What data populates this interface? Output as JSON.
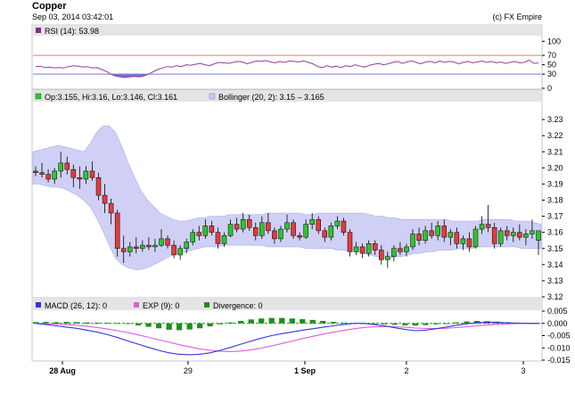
{
  "header": {
    "title": "Copper",
    "date": "Sep 03, 2014 03:42:01",
    "copyright": "(c) FX Empire"
  },
  "colors": {
    "up": "#2ec52e",
    "down": "#e33c3c",
    "band": "#c8c8f5",
    "rsi": "#9a3a9a",
    "macd": "#3535d9",
    "signal": "#e05be0",
    "divergence": "#1f8f1f",
    "panel_header": "#e4e4e4"
  },
  "x_labels": [
    "28 Aug",
    "29",
    "1 Sep",
    "2",
    "3"
  ],
  "chart_data": [
    {
      "type": "line",
      "panel": "rsi",
      "legend": "RSI (14): 53.98",
      "ylim": [
        0,
        110
      ],
      "yticks": [
        0,
        30,
        50,
        70,
        100
      ],
      "reference_lines": [
        30,
        70
      ],
      "series": [
        {
          "name": "RSI (14)",
          "values": [
            46,
            47,
            44,
            45,
            43,
            44,
            43,
            46,
            48,
            47,
            45,
            46,
            43,
            44,
            40,
            36,
            30,
            26,
            24,
            23,
            24,
            25,
            24,
            26,
            30,
            35,
            40,
            43,
            46,
            45,
            48,
            46,
            50,
            49,
            51,
            53,
            50,
            48,
            52,
            55,
            54,
            53,
            55,
            57,
            56,
            52,
            55,
            58,
            57,
            59,
            56,
            54,
            57,
            55,
            58,
            57,
            56,
            58,
            55,
            52,
            46,
            44,
            48,
            45,
            47,
            44,
            48,
            46,
            50,
            47,
            45,
            49,
            51,
            53,
            50,
            52,
            55,
            57,
            53,
            56,
            58,
            55,
            52,
            56,
            57,
            54,
            58,
            55,
            57,
            56,
            52,
            55,
            57,
            54,
            56,
            58,
            55,
            57,
            54,
            56,
            53,
            55,
            57,
            54,
            55,
            60,
            53,
            54
          ]
        }
      ]
    },
    {
      "type": "candlestick",
      "panel": "price",
      "legend_ohlc": "Op:3.155, Hi:3.16, Lo:3.146, Cl:3.161",
      "legend_bollinger": "Bollinger (20, 2): 3.15 – 3.165",
      "ylim": [
        3.12,
        3.24
      ],
      "yticks": [
        3.12,
        3.13,
        3.14,
        3.15,
        3.16,
        3.17,
        3.18,
        3.19,
        3.2,
        3.21,
        3.22,
        3.23
      ],
      "ohlc": [
        [
          3.198,
          3.201,
          3.195,
          3.197
        ],
        [
          3.197,
          3.203,
          3.194,
          3.196
        ],
        [
          3.196,
          3.199,
          3.191,
          3.193
        ],
        [
          3.193,
          3.2,
          3.19,
          3.198
        ],
        [
          3.198,
          3.21,
          3.194,
          3.203
        ],
        [
          3.203,
          3.207,
          3.196,
          3.199
        ],
        [
          3.199,
          3.202,
          3.188,
          3.194
        ],
        [
          3.194,
          3.201,
          3.187,
          3.193
        ],
        [
          3.193,
          3.201,
          3.19,
          3.198
        ],
        [
          3.198,
          3.204,
          3.192,
          3.194
        ],
        [
          3.194,
          3.197,
          3.18,
          3.183
        ],
        [
          3.183,
          3.19,
          3.172,
          3.178
        ],
        [
          3.178,
          3.181,
          3.165,
          3.172
        ],
        [
          3.172,
          3.174,
          3.145,
          3.15
        ],
        [
          3.15,
          3.158,
          3.141,
          3.148
        ],
        [
          3.148,
          3.154,
          3.145,
          3.151
        ],
        [
          3.151,
          3.157,
          3.147,
          3.15
        ],
        [
          3.15,
          3.155,
          3.148,
          3.152
        ],
        [
          3.152,
          3.157,
          3.149,
          3.151
        ],
        [
          3.151,
          3.156,
          3.148,
          3.152
        ],
        [
          3.152,
          3.162,
          3.151,
          3.156
        ],
        [
          3.156,
          3.158,
          3.15,
          3.152
        ],
        [
          3.152,
          3.155,
          3.144,
          3.146
        ],
        [
          3.146,
          3.152,
          3.143,
          3.15
        ],
        [
          3.15,
          3.156,
          3.147,
          3.154
        ],
        [
          3.154,
          3.162,
          3.152,
          3.16
        ],
        [
          3.16,
          3.164,
          3.155,
          3.158
        ],
        [
          3.158,
          3.168,
          3.156,
          3.164
        ],
        [
          3.164,
          3.167,
          3.158,
          3.16
        ],
        [
          3.16,
          3.163,
          3.15,
          3.153
        ],
        [
          3.153,
          3.16,
          3.151,
          3.158
        ],
        [
          3.158,
          3.168,
          3.157,
          3.165
        ],
        [
          3.165,
          3.169,
          3.16,
          3.162
        ],
        [
          3.162,
          3.172,
          3.16,
          3.168
        ],
        [
          3.168,
          3.171,
          3.161,
          3.163
        ],
        [
          3.163,
          3.166,
          3.155,
          3.158
        ],
        [
          3.158,
          3.17,
          3.156,
          3.166
        ],
        [
          3.166,
          3.172,
          3.159,
          3.161
        ],
        [
          3.161,
          3.163,
          3.153,
          3.156
        ],
        [
          3.156,
          3.164,
          3.154,
          3.162
        ],
        [
          3.162,
          3.171,
          3.16,
          3.166
        ],
        [
          3.166,
          3.168,
          3.156,
          3.158
        ],
        [
          3.158,
          3.16,
          3.155,
          3.157
        ],
        [
          3.157,
          3.168,
          3.156,
          3.165
        ],
        [
          3.165,
          3.172,
          3.162,
          3.168
        ],
        [
          3.168,
          3.17,
          3.159,
          3.161
        ],
        [
          3.161,
          3.163,
          3.154,
          3.157
        ],
        [
          3.157,
          3.166,
          3.155,
          3.164
        ],
        [
          3.164,
          3.17,
          3.162,
          3.167
        ],
        [
          3.167,
          3.169,
          3.158,
          3.16
        ],
        [
          3.16,
          3.162,
          3.145,
          3.148
        ],
        [
          3.148,
          3.154,
          3.146,
          3.151
        ],
        [
          3.151,
          3.153,
          3.144,
          3.147
        ],
        [
          3.147,
          3.155,
          3.145,
          3.153
        ],
        [
          3.153,
          3.155,
          3.146,
          3.149
        ],
        [
          3.149,
          3.152,
          3.14,
          3.143
        ],
        [
          3.143,
          3.148,
          3.138,
          3.145
        ],
        [
          3.145,
          3.152,
          3.142,
          3.15
        ],
        [
          3.15,
          3.154,
          3.146,
          3.148
        ],
        [
          3.148,
          3.153,
          3.145,
          3.151
        ],
        [
          3.151,
          3.162,
          3.149,
          3.159
        ],
        [
          3.159,
          3.163,
          3.152,
          3.155
        ],
        [
          3.155,
          3.164,
          3.153,
          3.161
        ],
        [
          3.161,
          3.166,
          3.156,
          3.158
        ],
        [
          3.158,
          3.167,
          3.155,
          3.164
        ],
        [
          3.164,
          3.168,
          3.154,
          3.157
        ],
        [
          3.157,
          3.162,
          3.152,
          3.16
        ],
        [
          3.16,
          3.163,
          3.15,
          3.153
        ],
        [
          3.153,
          3.158,
          3.149,
          3.156
        ],
        [
          3.156,
          3.16,
          3.148,
          3.151
        ],
        [
          3.151,
          3.164,
          3.15,
          3.162
        ],
        [
          3.162,
          3.17,
          3.159,
          3.165
        ],
        [
          3.165,
          3.177,
          3.16,
          3.163
        ],
        [
          3.163,
          3.166,
          3.15,
          3.153
        ],
        [
          3.153,
          3.163,
          3.151,
          3.161
        ],
        [
          3.161,
          3.164,
          3.155,
          3.158
        ],
        [
          3.158,
          3.163,
          3.154,
          3.16
        ],
        [
          3.16,
          3.165,
          3.155,
          3.157
        ],
        [
          3.157,
          3.162,
          3.152,
          3.159
        ],
        [
          3.159,
          3.168,
          3.156,
          3.161
        ],
        [
          3.155,
          3.16,
          3.146,
          3.161
        ]
      ],
      "bollinger": {
        "upper": [
          3.21,
          3.211,
          3.212,
          3.213,
          3.214,
          3.213,
          3.212,
          3.211,
          3.21,
          3.215,
          3.222,
          3.226,
          3.226,
          3.222,
          3.213,
          3.203,
          3.194,
          3.186,
          3.18,
          3.176,
          3.172,
          3.17,
          3.168,
          3.167,
          3.167,
          3.168,
          3.169,
          3.169,
          3.17,
          3.17,
          3.17,
          3.171,
          3.171,
          3.171,
          3.171,
          3.171,
          3.171,
          3.172,
          3.172,
          3.172,
          3.172,
          3.172,
          3.172,
          3.171,
          3.171,
          3.172,
          3.172,
          3.172,
          3.172,
          3.172,
          3.172,
          3.172,
          3.172,
          3.171,
          3.17,
          3.17,
          3.169,
          3.169,
          3.168,
          3.168,
          3.168,
          3.168,
          3.168,
          3.168,
          3.168,
          3.168,
          3.167,
          3.167,
          3.167,
          3.167,
          3.167,
          3.168,
          3.168,
          3.168,
          3.168,
          3.168,
          3.167,
          3.167,
          3.167,
          3.166,
          3.165
        ],
        "lower": [
          3.19,
          3.19,
          3.189,
          3.188,
          3.188,
          3.187,
          3.185,
          3.183,
          3.18,
          3.176,
          3.169,
          3.161,
          3.152,
          3.144,
          3.14,
          3.138,
          3.137,
          3.137,
          3.138,
          3.14,
          3.142,
          3.144,
          3.146,
          3.147,
          3.148,
          3.149,
          3.15,
          3.151,
          3.151,
          3.151,
          3.152,
          3.152,
          3.152,
          3.152,
          3.152,
          3.152,
          3.152,
          3.151,
          3.151,
          3.151,
          3.151,
          3.151,
          3.151,
          3.15,
          3.15,
          3.15,
          3.15,
          3.15,
          3.149,
          3.149,
          3.148,
          3.148,
          3.147,
          3.146,
          3.145,
          3.144,
          3.144,
          3.145,
          3.145,
          3.146,
          3.147,
          3.147,
          3.148,
          3.148,
          3.149,
          3.149,
          3.149,
          3.15,
          3.15,
          3.15,
          3.151,
          3.151,
          3.151,
          3.151,
          3.151,
          3.151,
          3.151,
          3.15,
          3.15,
          3.15,
          3.15
        ]
      }
    },
    {
      "type": "bar",
      "panel": "macd",
      "legend": [
        {
          "name": "MACD (26, 12): 0",
          "color": "#3535d9"
        },
        {
          "name": "EXP (9): 0",
          "color": "#e05be0"
        },
        {
          "name": "Divergence: 0",
          "color": "#1f8f1f"
        }
      ],
      "ylim": [
        -0.015,
        0.005
      ],
      "yticks": [
        0.005,
        0.0,
        -0.005,
        -0.01,
        -0.015
      ],
      "macd": [
        0.0,
        -0.0005,
        -0.001,
        -0.0015,
        -0.002,
        -0.0028,
        -0.0036,
        -0.0046,
        -0.0058,
        -0.0072,
        -0.0085,
        -0.0098,
        -0.011,
        -0.012,
        -0.0126,
        -0.0128,
        -0.0126,
        -0.012,
        -0.011,
        -0.0098,
        -0.0085,
        -0.0072,
        -0.006,
        -0.005,
        -0.0042,
        -0.0035,
        -0.0028,
        -0.0022,
        -0.0016,
        -0.001,
        -0.0005,
        0.0,
        0.0,
        -0.0005,
        -0.001,
        -0.0018,
        -0.0025,
        -0.003,
        -0.0028,
        -0.0022,
        -0.0015,
        -0.0008,
        -0.0002,
        0.0003,
        0.0005,
        0.0004,
        0.0002,
        0.0001,
        0.0,
        0.0
      ],
      "signal": [
        0.0,
        -0.0001,
        -0.0003,
        -0.0005,
        -0.0008,
        -0.0012,
        -0.0017,
        -0.0023,
        -0.003,
        -0.0038,
        -0.0047,
        -0.0057,
        -0.0067,
        -0.0077,
        -0.0087,
        -0.0096,
        -0.0104,
        -0.011,
        -0.0114,
        -0.0115,
        -0.0113,
        -0.0108,
        -0.0101,
        -0.0092,
        -0.0082,
        -0.0072,
        -0.0062,
        -0.0053,
        -0.0044,
        -0.0036,
        -0.0029,
        -0.0022,
        -0.0017,
        -0.0014,
        -0.0013,
        -0.0014,
        -0.0016,
        -0.0019,
        -0.0021,
        -0.0021,
        -0.002,
        -0.0017,
        -0.0014,
        -0.001,
        -0.0007,
        -0.0004,
        -0.0002,
        -0.0001,
        0.0,
        0.0
      ],
      "divergence": [
        0.0005,
        0.0006,
        0.0005,
        0.0006,
        0.0005,
        0.0004,
        0.0003,
        0.0002,
        0.0001,
        0.0,
        -0.0008,
        -0.0014,
        -0.002,
        -0.0026,
        -0.0028,
        -0.0025,
        -0.002,
        -0.0012,
        -0.0004,
        0.0004,
        0.001,
        0.0016,
        0.002,
        0.0022,
        0.0022,
        0.002,
        0.0017,
        0.0014,
        0.001,
        0.0006,
        0.0003,
        0.0001,
        0.0,
        -0.0002,
        -0.0004,
        -0.0006,
        -0.0008,
        -0.0009,
        -0.0007,
        -0.0004,
        0.0,
        0.0004,
        0.0008,
        0.001,
        0.0009,
        0.0007,
        0.0005,
        0.0003,
        0.0002,
        0.0001
      ]
    }
  ]
}
